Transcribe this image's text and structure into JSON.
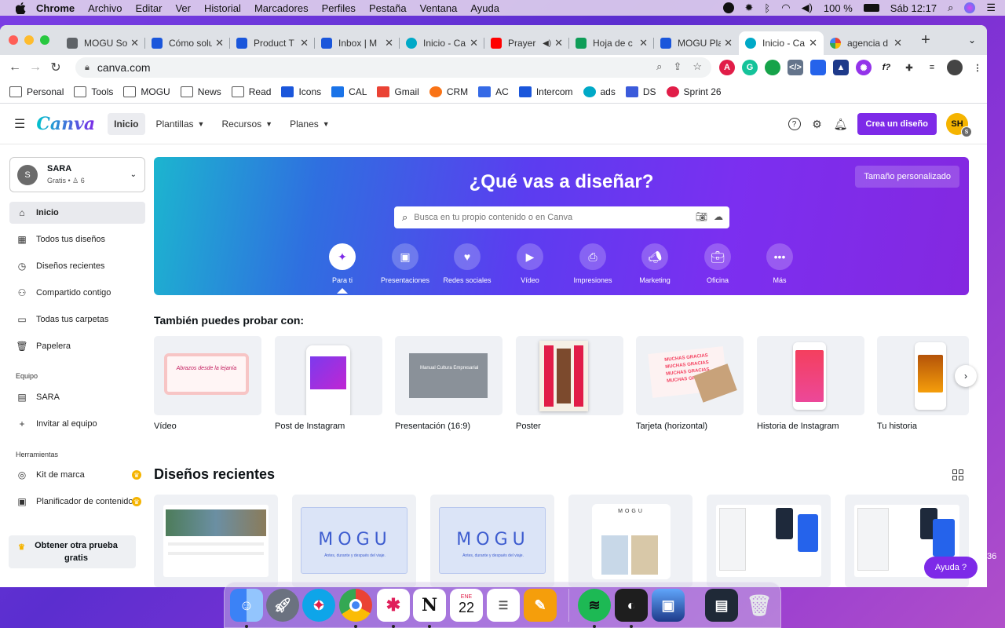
{
  "menubar": {
    "items": [
      "Chrome",
      "Archivo",
      "Editar",
      "Ver",
      "Historial",
      "Marcadores",
      "Perfiles",
      "Pestaña",
      "Ventana",
      "Ayuda"
    ],
    "battery": "100 %",
    "clock": "Sáb 12:17"
  },
  "tabs": [
    {
      "label": "MOGU So",
      "color": "#5f6368"
    },
    {
      "label": "Cómo solu",
      "color": "#1a56db"
    },
    {
      "label": "Product T",
      "color": "#1a56db"
    },
    {
      "label": "Inbox | M",
      "color": "#1a56db"
    },
    {
      "label": "Inicio - Ca",
      "color": "#00a9c7"
    },
    {
      "label": "Prayer",
      "color": "#ff0000"
    },
    {
      "label": "Hoja de c",
      "color": "#0f9d58"
    },
    {
      "label": "MOGU Pla",
      "color": "#1a56db"
    },
    {
      "label": "Inicio - Ca",
      "color": "#00a9c7"
    },
    {
      "label": "agencia d",
      "color": "#4285f4"
    }
  ],
  "omnibox": {
    "url": "canva.com"
  },
  "bookmarks": [
    {
      "label": "Personal",
      "color": "folder"
    },
    {
      "label": "Tools",
      "color": "folder"
    },
    {
      "label": "MOGU",
      "color": "folder"
    },
    {
      "label": "News",
      "color": "folder"
    },
    {
      "label": "Read",
      "color": "folder"
    },
    {
      "label": "Icons",
      "color": "#1a56db"
    },
    {
      "label": "CAL",
      "color": "#1a73e8"
    },
    {
      "label": "Gmail",
      "color": "#ea4335"
    },
    {
      "label": "CRM",
      "color": "#f97316"
    },
    {
      "label": "AC",
      "color": "#356ae6"
    },
    {
      "label": "Intercom",
      "color": "#1a56db"
    },
    {
      "label": "ads",
      "color": "#00a9c7"
    },
    {
      "label": "DS",
      "color": "#3b5bdb"
    },
    {
      "label": "Sprint 26",
      "color": "#e11d48"
    }
  ],
  "canva": {
    "nav": {
      "home": "Inicio",
      "templates": "Plantillas",
      "resources": "Recursos",
      "plans": "Planes"
    },
    "create_button": "Crea un diseño",
    "avatar": "SH",
    "avatar_badge": "S"
  },
  "sidebar": {
    "account": {
      "initial": "S",
      "name": "SARA",
      "plan": "Gratis",
      "members": "6"
    },
    "items": [
      "Inicio",
      "Todos tus diseños",
      "Diseños recientes",
      "Compartido contigo",
      "Todas tus carpetas",
      "Papelera"
    ],
    "team_heading": "Equipo",
    "team_items": [
      "SARA",
      "Invitar al equipo"
    ],
    "tools_heading": "Herramientas",
    "tools_items": [
      "Kit de marca",
      "Planificador de contenido"
    ],
    "trial": "Obtener otra prueba gratis"
  },
  "hero": {
    "title": "¿Qué vas a diseñar?",
    "custom_size": "Tamaño personalizado",
    "search_placeholder": "Busca en tu propio contenido o en Canva",
    "categories": [
      "Para ti",
      "Presentaciones",
      "Redes sociales",
      "Vídeo",
      "Impresiones",
      "Marketing",
      "Oficina",
      "Más"
    ]
  },
  "try_section": {
    "title": "También puedes probar con:",
    "items": [
      "Vídeo",
      "Post de Instagram",
      "Presentación (16:9)",
      "Poster",
      "Tarjeta (horizontal)",
      "Historia de Instagram",
      "Tu historia"
    ]
  },
  "recent": {
    "title": "Diseños recientes",
    "mogu_text": "MOGU",
    "mogu_sub": "Antes, durante y después del viaje."
  },
  "help_button": "Ayuda ?",
  "edge_number": "36"
}
